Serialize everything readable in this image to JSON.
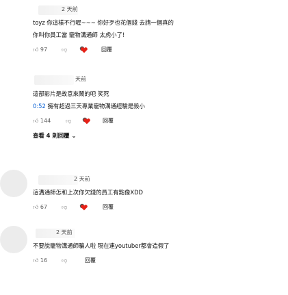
{
  "comments": [
    {
      "time": "2 天前",
      "lines": [
        "toyz 你這樣不行喔~~~ 你好歹也花個錢 去請一個真的",
        "你叫你員工當 寵物溝通師 太虎小了!"
      ],
      "likes": "97",
      "reply_label": "回覆"
    },
    {
      "time": "天前",
      "lines": [
        "這部影片是故意來鬧的吧 笑死"
      ],
      "timestamp": "0:52",
      "timestamp_text": "擁有超過三天專業寵物溝通經驗是殺小",
      "likes": "144",
      "reply_label": "回覆",
      "more_replies": "查看 4 則回覆"
    },
    {
      "time": "2 天前",
      "lines": [
        "這溝通師怎和上次你欠錢的員工有點像XDD"
      ],
      "likes": "67",
      "reply_label": "回覆"
    },
    {
      "time": "2 天前",
      "lines": [
        "不要說寵物溝通師騙人啦 現在連youtuber都會造假了"
      ],
      "likes": "16",
      "reply_label": "回覆"
    }
  ],
  "icons": {
    "thumb_up": "thumbs-up-icon",
    "thumb_down": "thumbs-down-icon",
    "creator_heart": "creator-heart-icon",
    "chevron": "chevron-down-icon"
  },
  "colors": {
    "link": "#065fd4",
    "heart": "#e62117",
    "text": "#0f0f0f",
    "secondary": "#606060"
  }
}
